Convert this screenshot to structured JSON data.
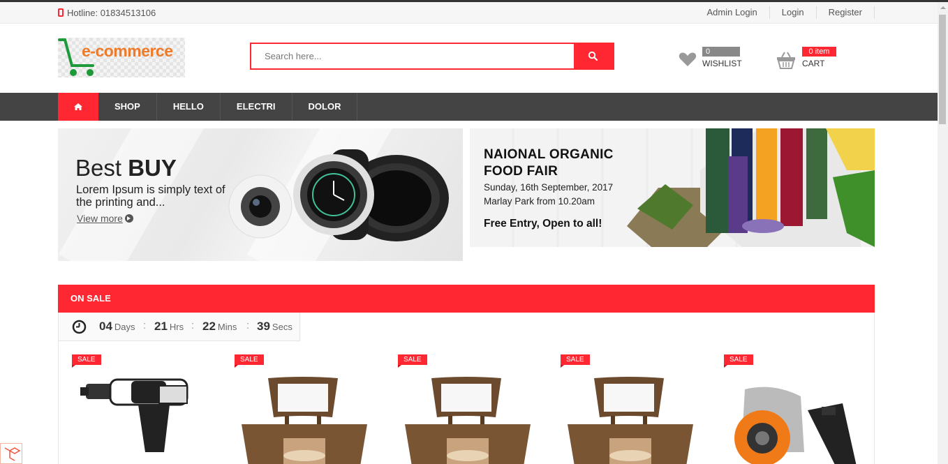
{
  "topbar": {
    "hotline": "Hotline: 01834513106",
    "links": [
      "Admin Login",
      "Login",
      "Register"
    ]
  },
  "header": {
    "logo_text": "e-commerce",
    "search_placeholder": "Search here...",
    "wishlist_count": "0",
    "wishlist_label": "WISHLIST",
    "cart_count": "0 item",
    "cart_label": "CART"
  },
  "nav": {
    "items": [
      "SHOP",
      "HELLO",
      "ELECTRI",
      "DOLOR"
    ]
  },
  "banner1": {
    "title_light": "Best ",
    "title_bold": "BUY",
    "description": "Lorem Ipsum is simply text of the printing and...",
    "link": "View more"
  },
  "banner2": {
    "title_line1": "NAIONAL ORGANIC",
    "title_line2": "FOOD FAIR",
    "date": "Sunday, 16th September, 2017",
    "place": "Marlay Park from 10.20am",
    "entry": "Free Entry, Open to all!"
  },
  "on_sale": {
    "title": "ON SALE",
    "countdown": {
      "days": "04",
      "days_label": "Days",
      "hrs": "21",
      "hrs_label": "Hrs",
      "mins": "22",
      "mins_label": "Mins",
      "secs": "39",
      "secs_label": "Secs",
      "separator": ":"
    },
    "badge": "SALE"
  },
  "colors": {
    "accent": "#ff2832",
    "nav_bg": "#444444"
  }
}
